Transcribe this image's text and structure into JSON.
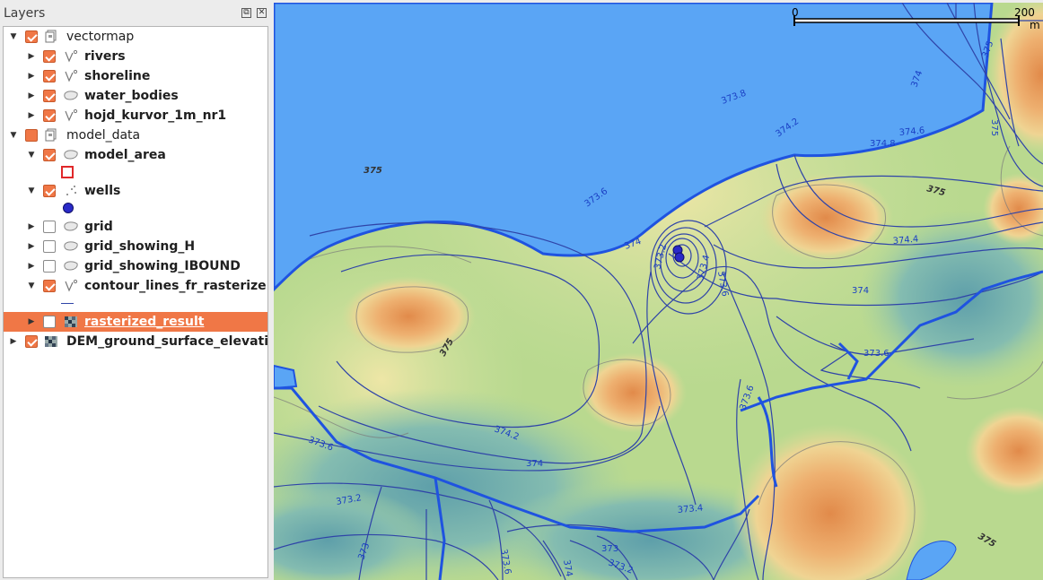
{
  "panel": {
    "title": "Layers"
  },
  "layers": [
    {
      "label": "vectormap",
      "type": "group",
      "checked": "checked",
      "expanded": true,
      "bold": false,
      "icon": "group-icon"
    },
    {
      "label": "rivers",
      "type": "line",
      "checked": "checked",
      "expanded": false,
      "bold": true,
      "icon": "line-layer-icon"
    },
    {
      "label": "shoreline",
      "type": "line",
      "checked": "checked",
      "expanded": false,
      "bold": true,
      "icon": "line-layer-icon"
    },
    {
      "label": "water_bodies",
      "type": "polygon",
      "checked": "checked",
      "expanded": false,
      "bold": true,
      "icon": "polygon-layer-icon"
    },
    {
      "label": "hojd_kurvor_1m_nr1",
      "type": "line",
      "checked": "checked",
      "expanded": false,
      "bold": true,
      "icon": "line-layer-icon"
    },
    {
      "label": "model_data",
      "type": "group",
      "checked": "partial",
      "expanded": true,
      "bold": false,
      "icon": "group-icon"
    },
    {
      "label": "model_area",
      "type": "polygon",
      "checked": "checked",
      "expanded": true,
      "bold": true,
      "icon": "polygon-layer-icon"
    },
    {
      "label": "wells",
      "type": "point",
      "checked": "checked",
      "expanded": true,
      "bold": true,
      "icon": "point-layer-icon"
    },
    {
      "label": "grid",
      "type": "polygon",
      "checked": "unchecked",
      "expanded": false,
      "bold": true,
      "icon": "polygon-layer-icon"
    },
    {
      "label": "grid_showing_H",
      "type": "polygon",
      "checked": "unchecked",
      "expanded": false,
      "bold": true,
      "icon": "polygon-layer-icon"
    },
    {
      "label": "grid_showing_IBOUND",
      "type": "polygon",
      "checked": "unchecked",
      "expanded": false,
      "bold": true,
      "icon": "polygon-layer-icon"
    },
    {
      "label": "contour_lines_fr_rasterize...",
      "type": "line",
      "checked": "checked",
      "expanded": true,
      "bold": true,
      "icon": "line-layer-icon"
    },
    {
      "label": "rasterized_result",
      "type": "raster",
      "checked": "unchecked",
      "expanded": false,
      "bold": true,
      "selected": true,
      "icon": "raster-layer-icon"
    },
    {
      "label": "DEM_ground_surface_elevati...",
      "type": "raster",
      "checked": "checked",
      "expanded": false,
      "bold": true,
      "icon": "raster-layer-icon"
    }
  ],
  "map": {
    "scale_bar": {
      "start": "0",
      "end": "200",
      "unit": "m"
    },
    "contour_labels": [
      "373.8",
      "374.2",
      "374.6",
      "374.8",
      "373.6",
      "374",
      "374.4",
      "374",
      "373.6",
      "373.6",
      "374.2",
      "373.6",
      "374",
      "373.2",
      "373.4",
      "373",
      "373.6",
      "374",
      "373",
      "373.2",
      "373.2",
      "373.4",
      "373.6",
      "374",
      "375",
      "375"
    ],
    "ground_labels": [
      "375",
      "375",
      "375",
      "375"
    ],
    "colors": {
      "water": "#5aa5f5",
      "shoreline": "#1f53e0",
      "contour": "#2f44a8",
      "highland": "#e6a05a",
      "lowland": "#7fb7b4",
      "well": "#2a2ac8"
    }
  }
}
